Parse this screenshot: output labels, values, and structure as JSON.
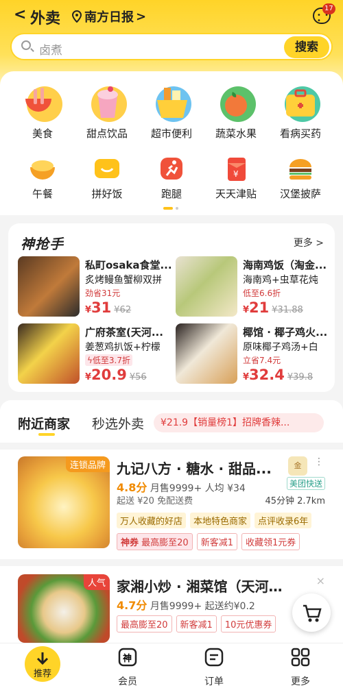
{
  "header": {
    "back": "<",
    "title": "外卖",
    "location": "南方日报",
    "location_arrow": ">",
    "message_badge": "17"
  },
  "search": {
    "placeholder": "卤煮",
    "button": "搜索"
  },
  "categories": [
    "美食",
    "甜点饮品",
    "超市便利",
    "蔬菜水果",
    "看病买药",
    "午餐",
    "拼好饭",
    "跑腿",
    "天天津贴",
    "汉堡披萨"
  ],
  "flash": {
    "title": "神抢手",
    "more": "更多 >",
    "items": [
      {
        "name": "私町osaka食堂...",
        "desc": "炙烤鳗鱼蟹柳双拼",
        "save": "劲省31元",
        "price": "31",
        "orig": "¥62"
      },
      {
        "name": "海南鸡饭（淘金...",
        "desc": "海南鸡+虫草花炖",
        "save": "低至6.6折",
        "price": "21",
        "orig": "¥31.88"
      },
      {
        "name": "广府茶室(天河...",
        "desc": "姜葱鸡扒饭+柠檬",
        "save": "低至3.7折",
        "price": "20.9",
        "orig": "¥56"
      },
      {
        "name": "椰馆 · 椰子鸡火...",
        "desc": "原味椰子鸡汤+白",
        "save": "立省7.4元",
        "price": "32.4",
        "orig": "¥39.8"
      }
    ]
  },
  "tabs": {
    "nearby": "附近商家",
    "seconds": "秒选外卖",
    "promo": "¥21.9【销量榜1】招牌香辣..."
  },
  "shops": [
    {
      "ribbon": "连锁品牌",
      "name": "九记八方 · 糖水 · 甜品...",
      "rating": "4.8分",
      "sales": "月售9999+",
      "avg": "人均 ¥34",
      "min": "起送 ¥20",
      "fee": "免配送费",
      "time": "45分钟",
      "dist": "2.7km",
      "badge": "金",
      "fast": "美团快送",
      "tags1": [
        "万人收藏的好店",
        "本地特色商家",
        "点评收录6年"
      ],
      "tags2": [
        "神券",
        "最高膨至20",
        "新客减1",
        "收藏领1元券"
      ]
    },
    {
      "ribbon": "人气",
      "name": "家湘小炒 · 湘菜馆（天河店）",
      "rating": "4.7分",
      "sales": "月售9999+",
      "fee": "起送约¥0.2",
      "tags1": [
        "最高膨至20",
        "新客减1",
        "10元优惠券"
      ]
    }
  ],
  "nav": [
    "推荐",
    "会员",
    "订单",
    "更多"
  ]
}
